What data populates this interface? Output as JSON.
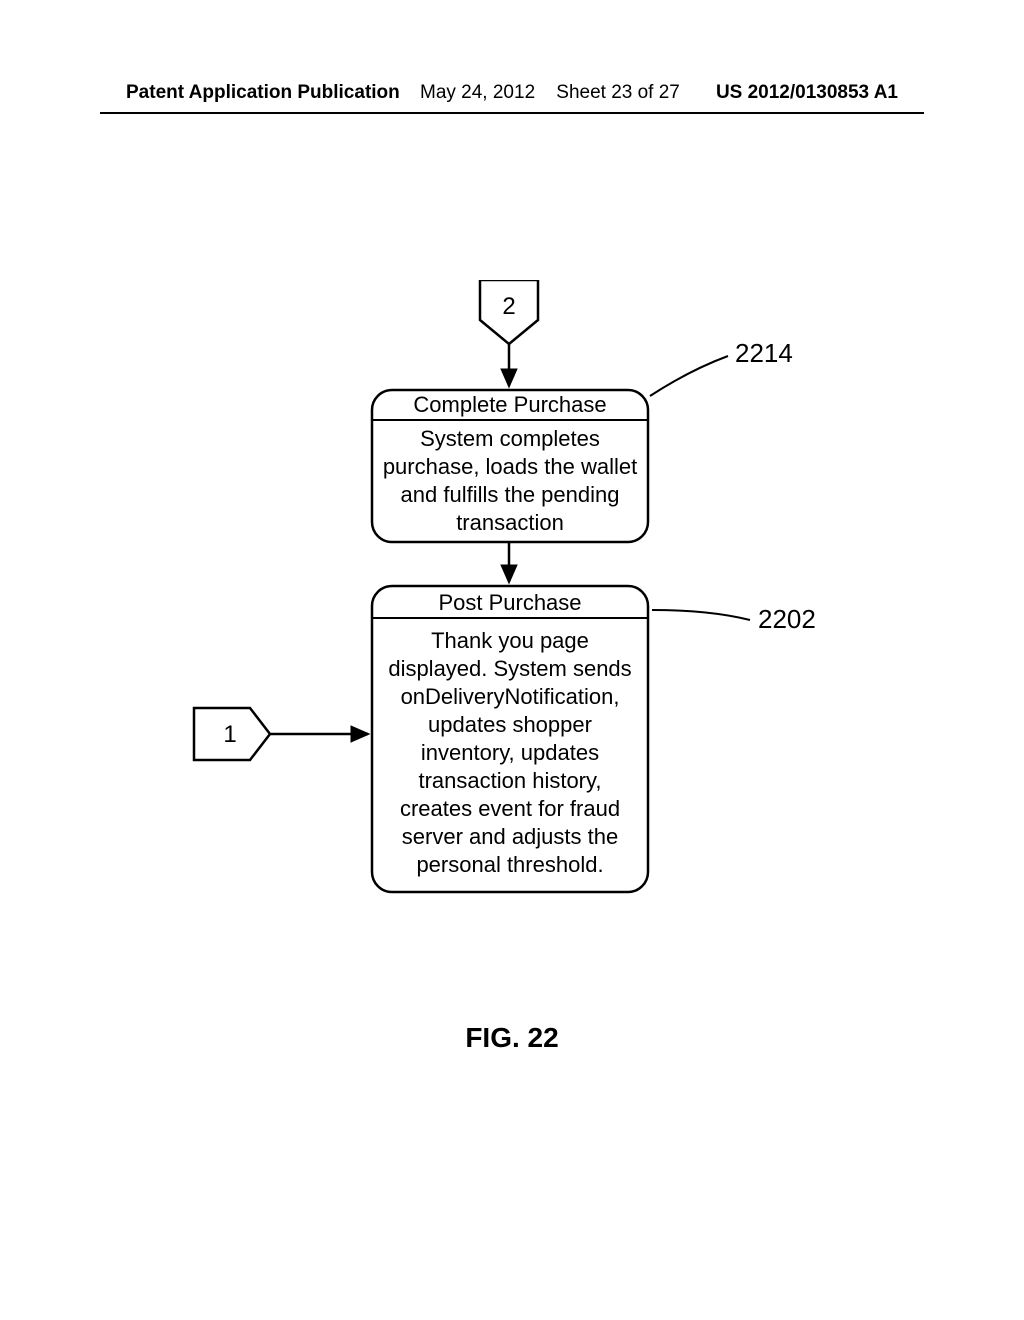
{
  "header": {
    "left": "Patent Application Publication",
    "date": "May 24, 2012",
    "sheet": "Sheet 23 of 27",
    "pubno": "US 2012/0130853 A1"
  },
  "figure_caption": "FIG. 22",
  "connectors": {
    "top": "2",
    "left": "1"
  },
  "refs": {
    "complete_purchase": "2214",
    "post_purchase": "2202"
  },
  "boxes": {
    "complete_purchase": {
      "title": "Complete Purchase",
      "body_l1": "System completes",
      "body_l2": "purchase, loads the wallet",
      "body_l3": "and fulfills the pending",
      "body_l4": "transaction"
    },
    "post_purchase": {
      "title": "Post Purchase",
      "body_l1": "Thank you page",
      "body_l2": "displayed.  System sends",
      "body_l3": "onDeliveryNotification,",
      "body_l4": "updates shopper",
      "body_l5": "inventory, updates",
      "body_l6": "transaction history,",
      "body_l7": "creates event for fraud",
      "body_l8": "server and adjusts the",
      "body_l9": "personal threshold."
    }
  }
}
